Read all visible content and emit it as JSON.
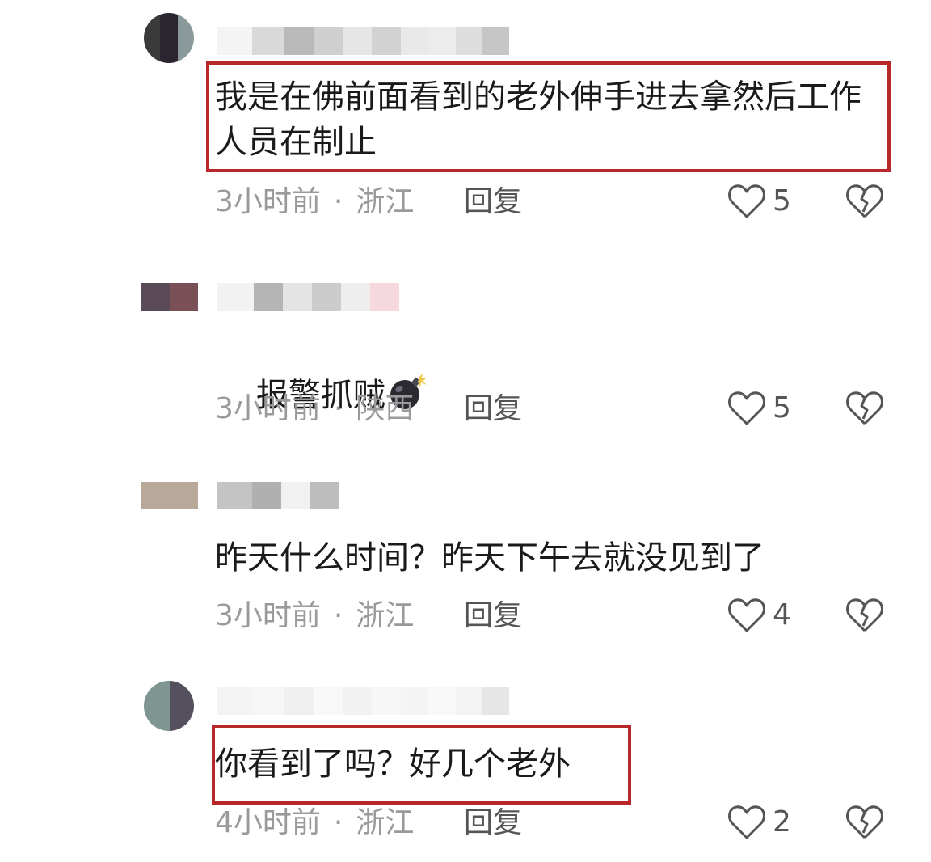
{
  "comments": [
    {
      "text": "我是在佛前面看到的老外伸手进去拿然后工作人员在制止",
      "time": "3小时前",
      "separator": "·",
      "location": "浙江",
      "reply_label": "回复",
      "likes": "5",
      "highlighted": true
    },
    {
      "text": "报警抓贼",
      "emoji": "bomb-emoji",
      "time": "3小时前",
      "separator": "·",
      "location": "陕西",
      "reply_label": "回复",
      "likes": "5",
      "highlighted": false
    },
    {
      "text": "昨天什么时间？昨天下午去就没见到了",
      "time": "3小时前",
      "separator": "·",
      "location": "浙江",
      "reply_label": "回复",
      "likes": "4",
      "highlighted": false
    },
    {
      "text": "你看到了吗？好几个老外",
      "time": "4小时前",
      "separator": "·",
      "location": "浙江",
      "reply_label": "回复",
      "likes": "2",
      "highlighted": true
    }
  ],
  "colors": {
    "highlight_border": "#b8282b",
    "meta_text": "#9a9a9a",
    "icon_stroke": "#555555"
  }
}
